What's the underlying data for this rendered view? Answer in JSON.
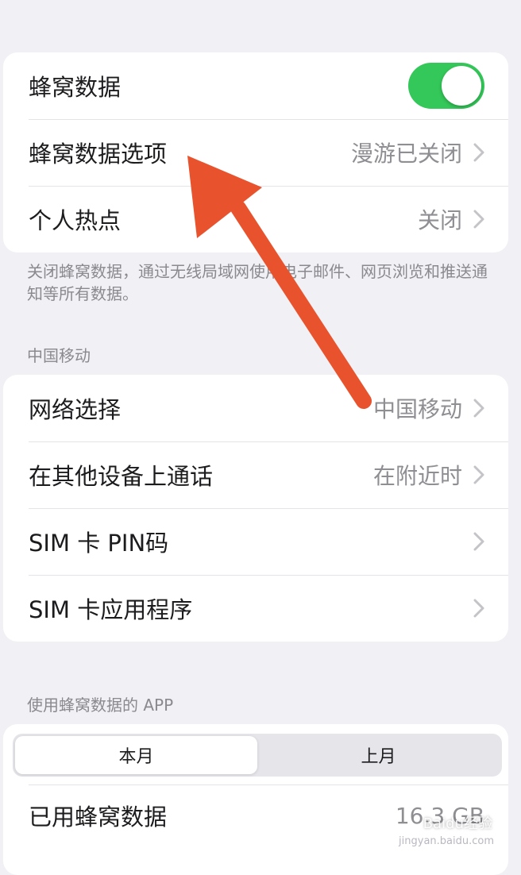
{
  "section1": {
    "rows": [
      {
        "label": "蜂窝数据",
        "toggle_on": true
      },
      {
        "label": "蜂窝数据选项",
        "value": "漫游已关闭"
      },
      {
        "label": "个人热点",
        "value": "关闭"
      }
    ],
    "footnote": "关闭蜂窝数据，通过无线局域网使用电子邮件、网页浏览和推送通知等所有数据。"
  },
  "section2": {
    "header": "中国移动",
    "rows": [
      {
        "label": "网络选择",
        "value": "中国移动"
      },
      {
        "label": "在其他设备上通话",
        "value": "在附近时"
      },
      {
        "label": "SIM 卡 PIN码",
        "value": ""
      },
      {
        "label": "SIM 卡应用程序",
        "value": ""
      }
    ]
  },
  "section3": {
    "header": "使用蜂窝数据的 APP",
    "segments": [
      "本月",
      "上月"
    ],
    "selected_segment": "本月",
    "usage_label": "已用蜂窝数据",
    "usage_value": "16.3 GB"
  },
  "watermark": {
    "text": "Baidu经验",
    "url": "jingyan.baidu.com"
  },
  "colors": {
    "toggle_on": "#34c759",
    "annotation_arrow": "#e8532e"
  }
}
